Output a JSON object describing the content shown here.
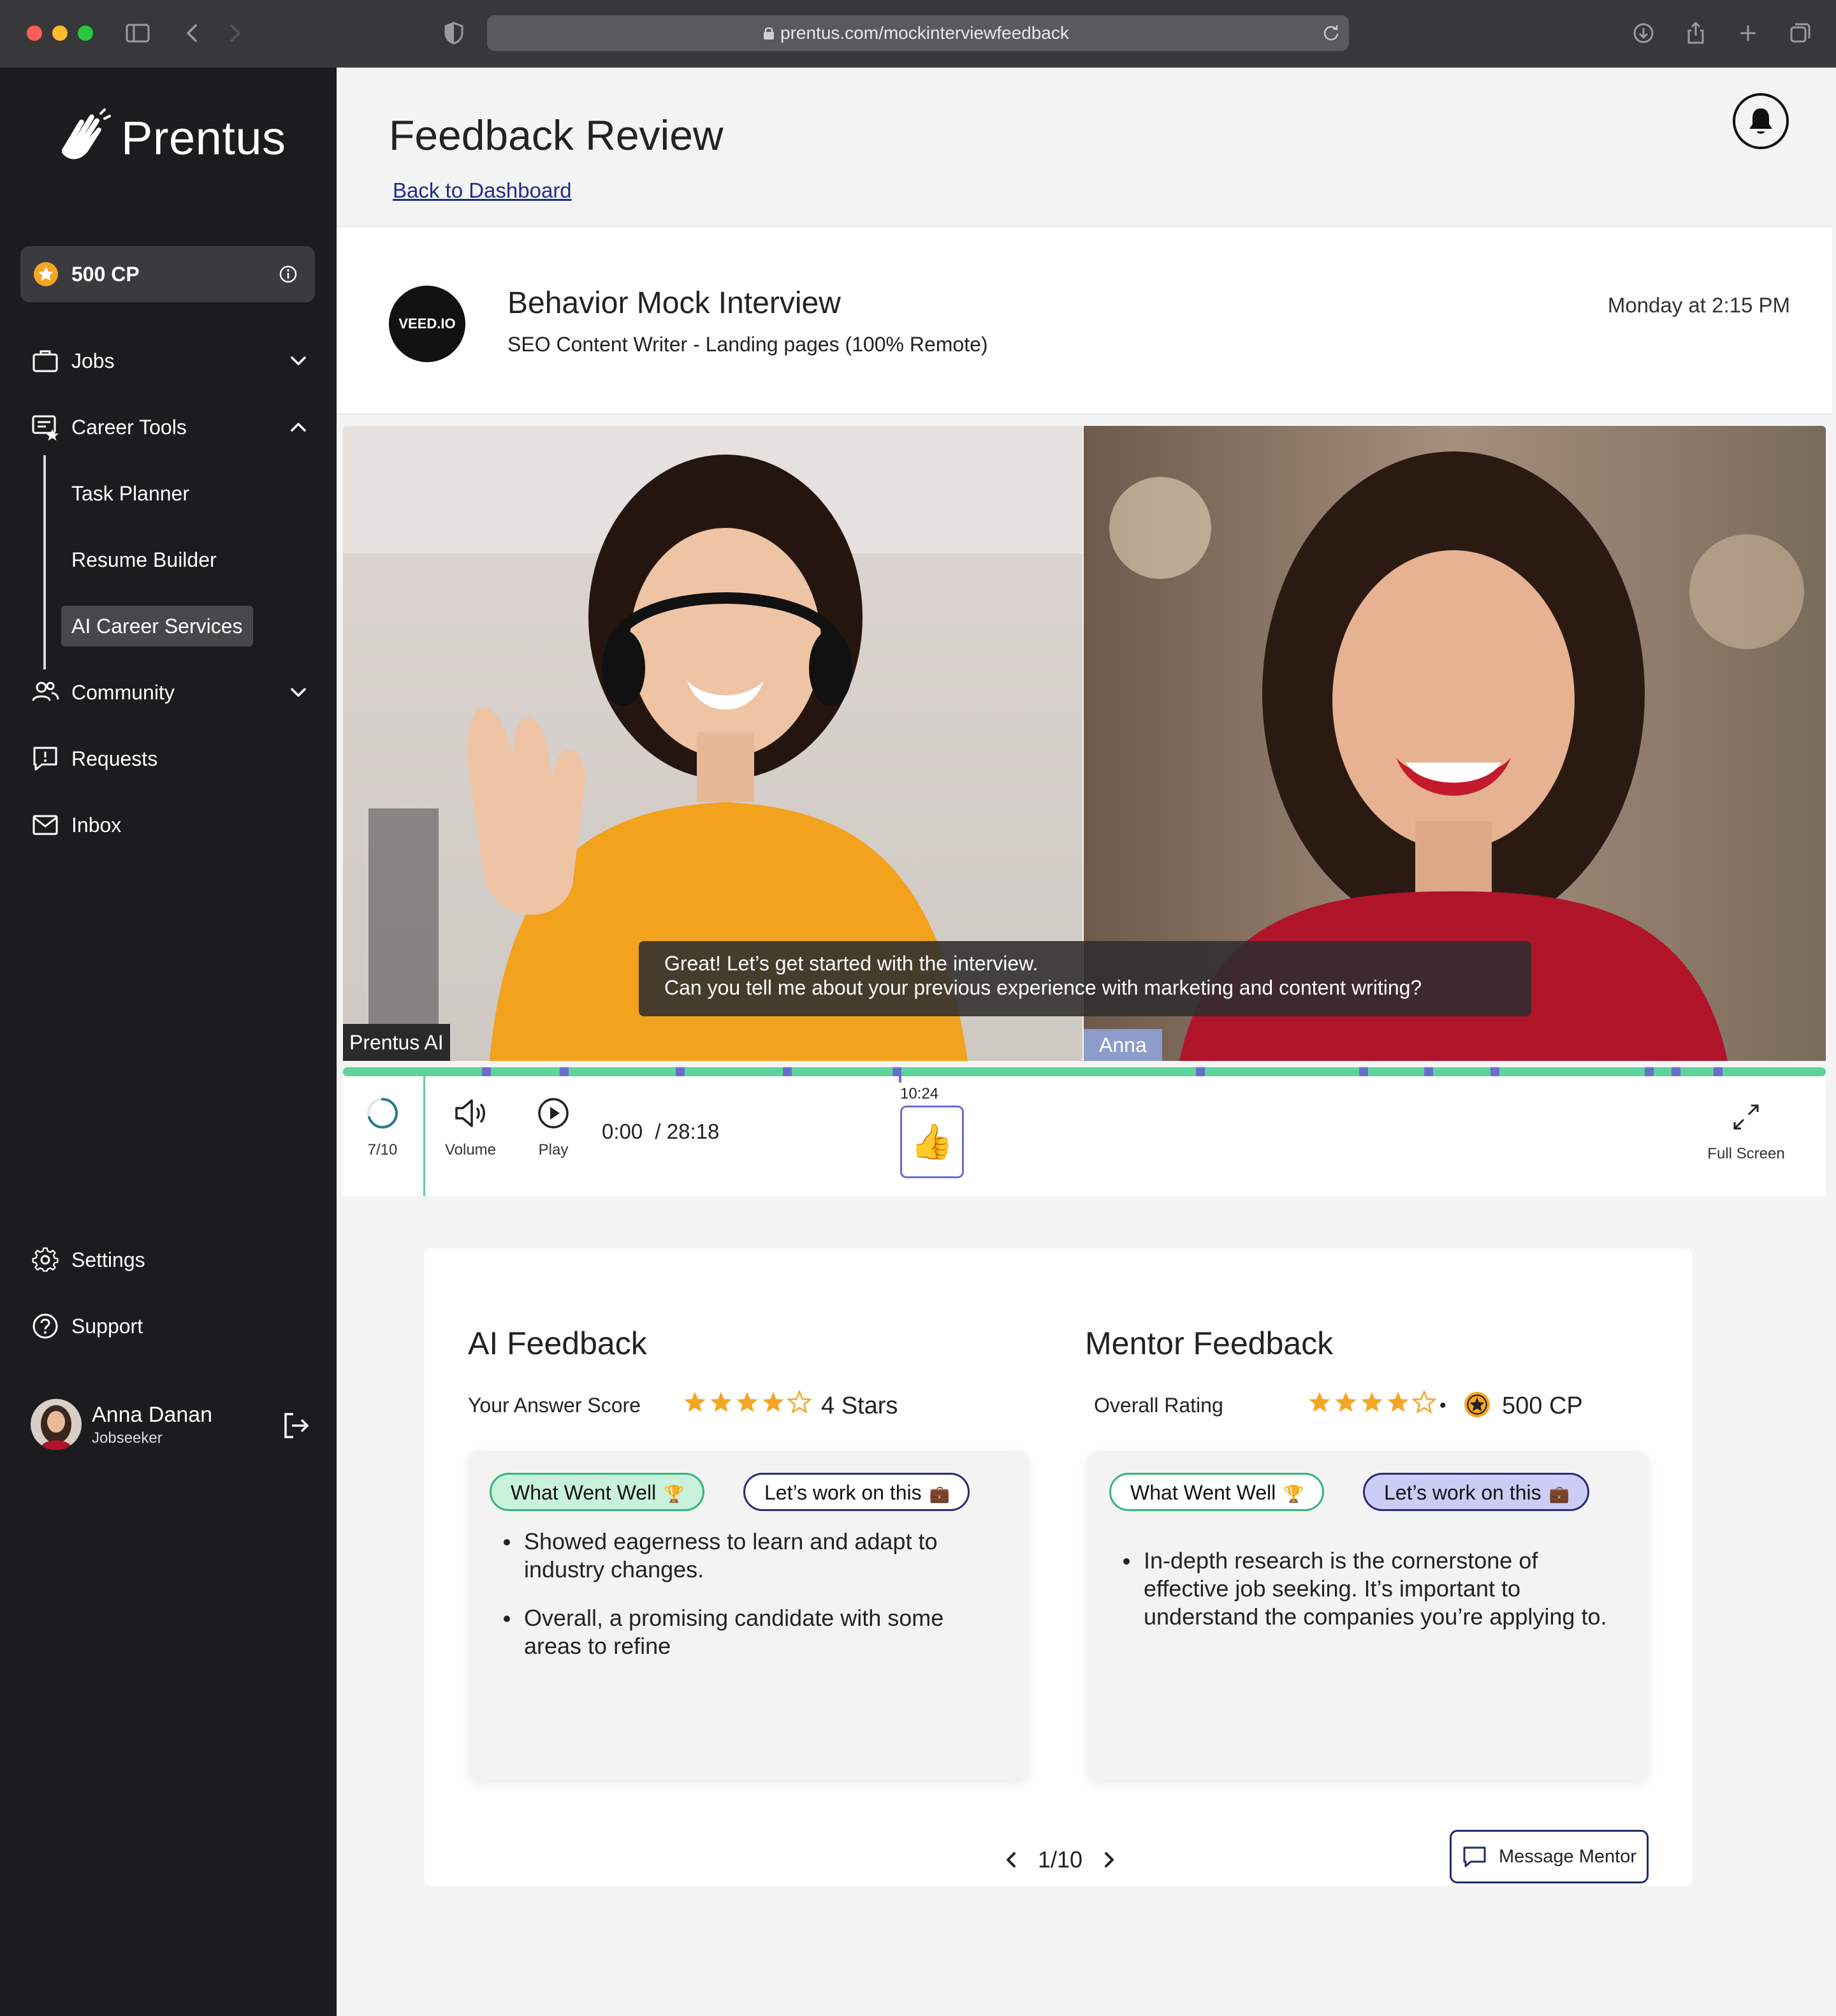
{
  "browser": {
    "url": "prentus.com/mockinterviewfeedback",
    "traffic_colors": [
      "#ff5f57",
      "#febc2e",
      "#28c840"
    ]
  },
  "sidebar": {
    "brand": "Prentus",
    "cp_label": "500 CP",
    "nav": {
      "jobs": "Jobs",
      "career_tools": "Career Tools",
      "task_planner": "Task Planner",
      "resume_builder": "Resume Builder",
      "ai_career_services": "AI Career Services",
      "community": "Community",
      "requests": "Requests",
      "inbox": "Inbox",
      "settings": "Settings",
      "support": "Support"
    },
    "user": {
      "name": "Anna Danan",
      "role": "Jobseeker"
    }
  },
  "header": {
    "title": "Feedback Review",
    "back_link": "Back to Dashboard"
  },
  "interview": {
    "logo_text": "VEED.IO",
    "title": "Behavior Mock Interview",
    "subtitle": "SEO Content Writer - Landing pages (100% Remote)",
    "date": "Monday at 2:15 PM"
  },
  "video": {
    "left_name": "Prentus AI",
    "right_name": "Anna",
    "caption_line1": "Great! Let’s get started with the interview.",
    "caption_line2": "Can you tell me about your previous experience with marketing and content writing?",
    "progress_label": "7/10",
    "progress_fraction": 0.7,
    "volume_label": "Volume",
    "play_label": "Play",
    "current_time": "0:00",
    "duration": "/ 28:18",
    "marker_time": "10:24",
    "marker_emoji": "👍",
    "fullscreen_label": "Full Screen",
    "accent": "#5ed39a",
    "marker_color": "#6c6ccf"
  },
  "ai_feedback": {
    "title": "AI Feedback",
    "score_label": "Your Answer Score",
    "rating": 4,
    "score_text": "4 Stars",
    "chip_well": "What Went Well",
    "chip_well_emoji": "🏆",
    "chip_work": "Let’s work on this",
    "chip_work_emoji": "💼",
    "points": [
      "Showed eagerness to learn and adapt to industry changes.",
      "Overall, a promising candidate with some areas to refine"
    ]
  },
  "mentor_feedback": {
    "title": "Mentor Feedback",
    "rating_label": "Overall Rating",
    "rating": 4,
    "bullet_sep": "•",
    "cp_text": "500 CP",
    "chip_well": "What Went Well",
    "chip_well_emoji": "🏆",
    "chip_work": "Let’s work on this",
    "chip_work_emoji": "💼",
    "points": [
      "In-depth research is the cornerstone of effective job seeking. It’s important to understand the companies you’re applying to."
    ]
  },
  "pager": {
    "label": "1/10"
  },
  "message_button": "Message Mentor",
  "star_color": "#f5a524"
}
